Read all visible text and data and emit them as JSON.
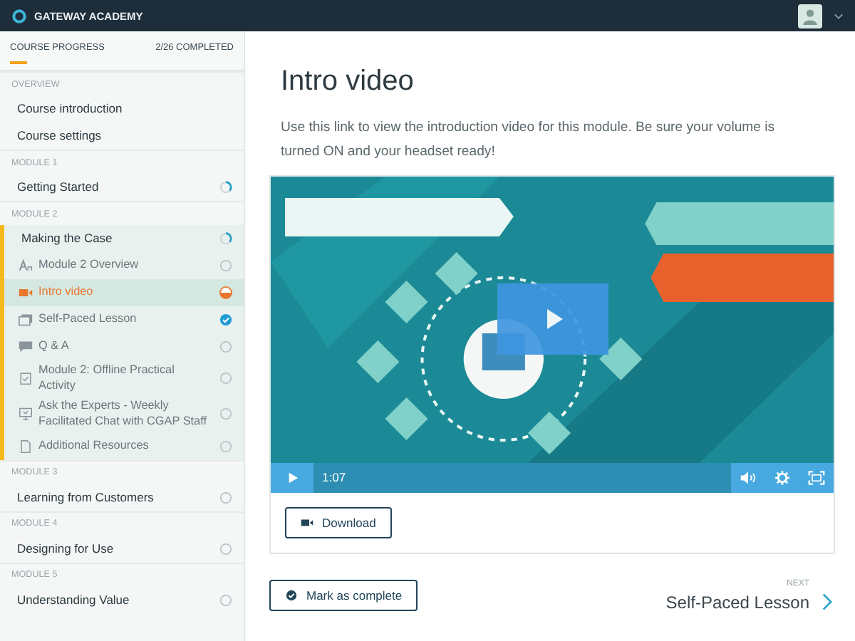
{
  "topbar": {
    "brand": "GATEWAY ACADEMY"
  },
  "sidebar": {
    "progress_label": "COURSE PROGRESS",
    "progress_count": "2/26 COMPLETED",
    "level": 0.077,
    "sections": [
      {
        "heading": "OVERVIEW",
        "items": [
          {
            "label": "Course introduction",
            "selected": false
          },
          {
            "label": "Course settings",
            "selected": false
          }
        ]
      },
      {
        "heading": "MODULE 1",
        "items": [
          {
            "label": "Getting Started",
            "completed": false,
            "in_progress": true,
            "selected": false
          }
        ]
      },
      {
        "heading": "MODULE 2",
        "items": [
          {
            "label": "Making the Case",
            "completed": false,
            "in_progress": true,
            "selected": false,
            "expanded": true,
            "children": [
              {
                "label": "Module 2 Overview",
                "kind": "text",
                "completed": false,
                "in_progress": false,
                "selected": false
              },
              {
                "label": "Intro video",
                "kind": "video",
                "completed": false,
                "in_progress": true,
                "selected": true
              },
              {
                "label": "Self-Paced Lesson",
                "kind": "lesson",
                "completed": true,
                "selected": false
              },
              {
                "label": "Q & A",
                "kind": "discussion",
                "completed": false,
                "in_progress": false,
                "selected": false
              },
              {
                "label": "Module 2: Offline Practical Activity",
                "kind": "activity",
                "completed": false,
                "in_progress": false,
                "selected": false
              },
              {
                "label": "Ask the Experts - Weekly Facilitated Chat with CGAP Staff",
                "kind": "chat",
                "completed": false,
                "in_progress": false,
                "selected": false
              },
              {
                "label": "Additional Resources",
                "kind": "document",
                "completed": false,
                "in_progress": false,
                "selected": false
              }
            ]
          }
        ]
      },
      {
        "heading": "MODULE 3",
        "items": [
          {
            "label": "Learning from Customers",
            "completed": false,
            "in_progress": false,
            "selected": false
          }
        ]
      },
      {
        "heading": "MODULE 4",
        "items": [
          {
            "label": "Designing for Use",
            "completed": false,
            "in_progress": false,
            "selected": false
          }
        ]
      },
      {
        "heading": "MODULE 5",
        "items": [
          {
            "label": "Understanding Value",
            "completed": false,
            "in_progress": false,
            "selected": false
          }
        ]
      }
    ]
  },
  "main": {
    "title": "Intro video",
    "description": "Use this link to view the introduction video for this module. Be sure your volume is turned ON and your headset ready!",
    "video": {
      "kind": "picture",
      "time": "1:07"
    },
    "download_button": "Download",
    "complete_button": "Mark as complete",
    "next_label": "NEXT",
    "next_title": "Self-Paced Lesson"
  }
}
